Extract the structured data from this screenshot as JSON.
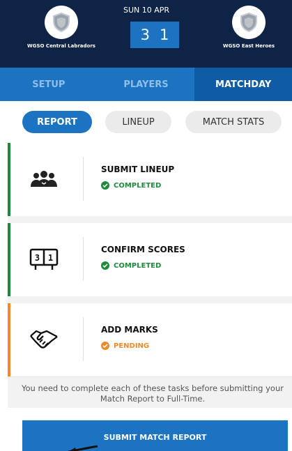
{
  "match": {
    "date": "SUN 10 APR",
    "home_score": "3",
    "away_score": "1",
    "home_team": "WGSO Central Labradors",
    "away_team": "WGSO East Heroes"
  },
  "tabs": [
    {
      "label": "SETUP"
    },
    {
      "label": "PLAYERS"
    },
    {
      "label": "MATCHDAY"
    }
  ],
  "subtabs": [
    {
      "label": "REPORT"
    },
    {
      "label": "LINEUP"
    },
    {
      "label": "MATCH STATS"
    }
  ],
  "tasks": [
    {
      "title": "SUBMIT LINEUP",
      "status": "COMPLETED",
      "color": "#1e8a3c",
      "icon": "team-icon"
    },
    {
      "title": "CONFIRM SCORES",
      "status": "COMPLETED",
      "color": "#1e8a3c",
      "icon": "scoreboard-icon"
    },
    {
      "title": "ADD MARKS",
      "status": "PENDING",
      "color": "#ef8a2a",
      "icon": "handshake-icon"
    }
  ],
  "notice": "You need to complete each of these tasks before submitting your Match Report to Full-Time.",
  "submit_label": "SUBMIT MATCH REPORT",
  "scoreboard_digits": [
    "3",
    "1"
  ],
  "colors": {
    "navy": "#0f2346",
    "blue": "#1b73c2",
    "green": "#1e8a3c",
    "orange": "#ef8a2a"
  }
}
